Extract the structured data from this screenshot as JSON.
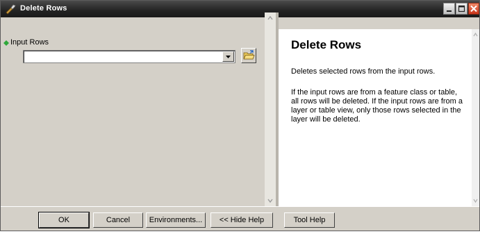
{
  "window": {
    "title": "Delete Rows",
    "controls": {
      "minimize_icon": "minimize-icon",
      "maximize_icon": "maximize-icon",
      "close_icon": "close-icon"
    }
  },
  "parameters": {
    "input_rows": {
      "label": "Input Rows",
      "value": "",
      "required_indicator_color": "#2fa83a",
      "browse_icon": "open-folder-icon"
    }
  },
  "help": {
    "title": "Delete Rows",
    "summary": "Deletes selected rows from the input rows.",
    "description": "If the input rows are from a feature class or table, all rows will be deleted. If the input rows are from a layer or table view, only those rows selected in the layer will be deleted."
  },
  "buttons": {
    "ok": "OK",
    "cancel": "Cancel",
    "environments": "Environments...",
    "hide_help": "<< Hide Help",
    "tool_help": "Tool Help"
  },
  "colors": {
    "title_bar": "#2a2a2a",
    "dialog_bg": "#d4d0c8",
    "close_button": "#d9512c"
  }
}
